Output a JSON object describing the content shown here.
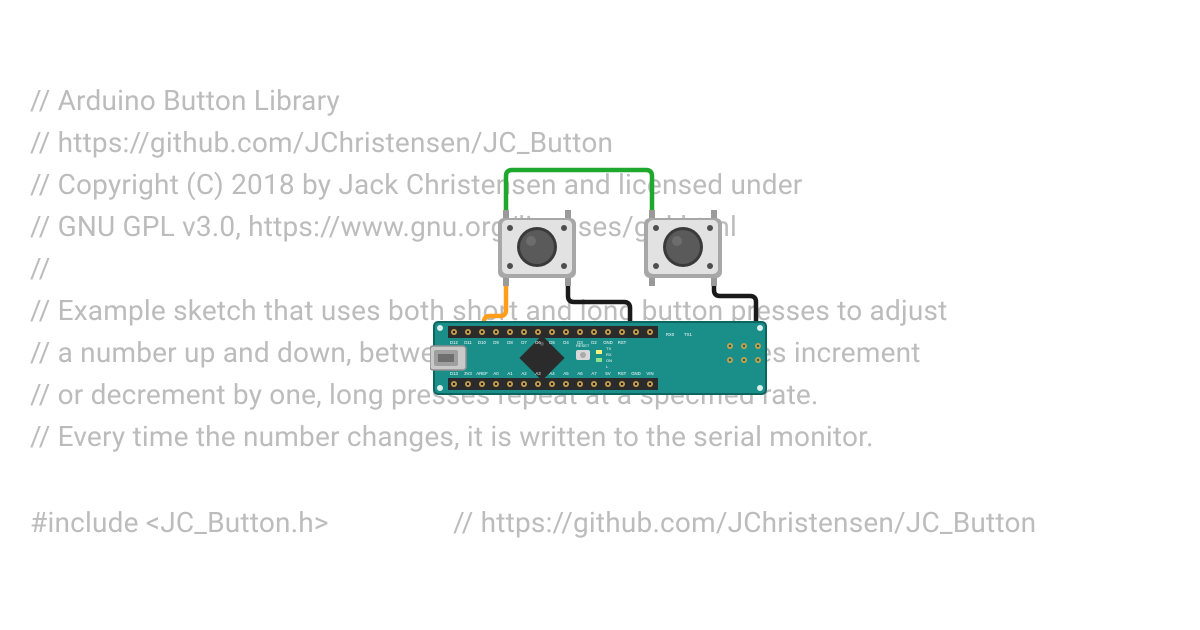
{
  "code": {
    "line1": "// Arduino Button Library",
    "line2": "// https://github.com/JChristensen/JC_Button",
    "line3": "// Copyright (C) 2018 by Jack Christensen and licensed under",
    "line4": "// GNU GPL v3.0, https://www.gnu.org/licenses/gpl.html",
    "line5": "//",
    "line6": "// Example sketch that uses both short and long button presses to adjust",
    "line7": "// a number up and down, between two limits. Short presses increment",
    "line8": "// or decrement by one, long presses repeat at a specified rate.",
    "line9": "// Every time the number changes, it is written to the serial monitor.",
    "line10a": "#include <JC_Button.h>",
    "line10b": "// https://github.com/JChristensen/JC_Button"
  },
  "board": {
    "pins_top": [
      "D12",
      "D11",
      "D10",
      "D9",
      "D8",
      "D7",
      "D6",
      "D5",
      "D4",
      "D3",
      "D2",
      "GND",
      "RST",
      "RX0",
      "TX1"
    ],
    "pins_bottom": [
      "D13",
      "3V3",
      "AREF",
      "A0",
      "A1",
      "A2",
      "A3",
      "A4",
      "A5",
      "A6",
      "A7",
      "5V",
      "RST",
      "GND",
      "VIN"
    ],
    "side_labels": [
      "RESET",
      "TX",
      "RX",
      "ON",
      "L"
    ]
  },
  "colors": {
    "board_pcb": "#1a8f8a",
    "board_pcb_dark": "#0d6560",
    "wire_green": "#1fa82e",
    "wire_orange": "#ff9e1b",
    "wire_black": "#1a1a1a",
    "button_body": "#dcdcdc",
    "button_body_shadow": "#a7a7a7",
    "button_cap": "#4e4e4e"
  }
}
